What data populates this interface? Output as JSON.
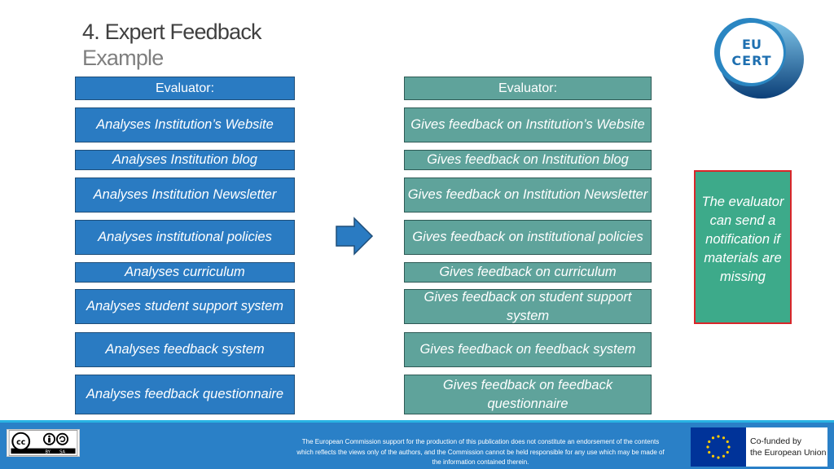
{
  "header": {
    "title": "4. Expert Feedback",
    "subtitle": "Example"
  },
  "logo": {
    "line1": "EU",
    "line2": "CERT"
  },
  "left_column": {
    "header": "Evaluator:",
    "items": [
      "Analyses Institution’s Website",
      "Analyses Institution blog",
      "Analyses Institution Newsletter",
      "Analyses institutional policies",
      "Analyses curriculum",
      "Analyses student support system",
      "Analyses feedback system",
      "Analyses feedback questionnaire"
    ]
  },
  "right_column": {
    "header": "Evaluator:",
    "items": [
      "Gives feedback on Institution’s Website",
      "Gives feedback on Institution blog",
      "Gives feedback on Institution Newsletter",
      "Gives feedback on institutional policies",
      "Gives feedback on curriculum",
      "Gives feedback on student support system",
      "Gives feedback on feedback system",
      "Gives feedback on feedback questionnaire"
    ]
  },
  "arrow_icon": "right-arrow-icon",
  "note": "The evaluator can send a notification if materials are missing",
  "footer": {
    "license": {
      "by": "BY",
      "sa": "SA"
    },
    "disclaimer": "The European Commission support for the production of this publication does not constitute an endorsement of the contents which reflects the views only of the authors, and the Commission cannot be held responsible for any use which may be made of the information contained therein.",
    "eu_funding": {
      "line1": "Co-funded by",
      "line2": "the European Union"
    }
  },
  "colors": {
    "left_box": "#2a7bc2",
    "right_box": "#5fa39b",
    "note_box": "#3daa8a",
    "note_border": "#d9262a",
    "footer": "#2a80c7"
  }
}
